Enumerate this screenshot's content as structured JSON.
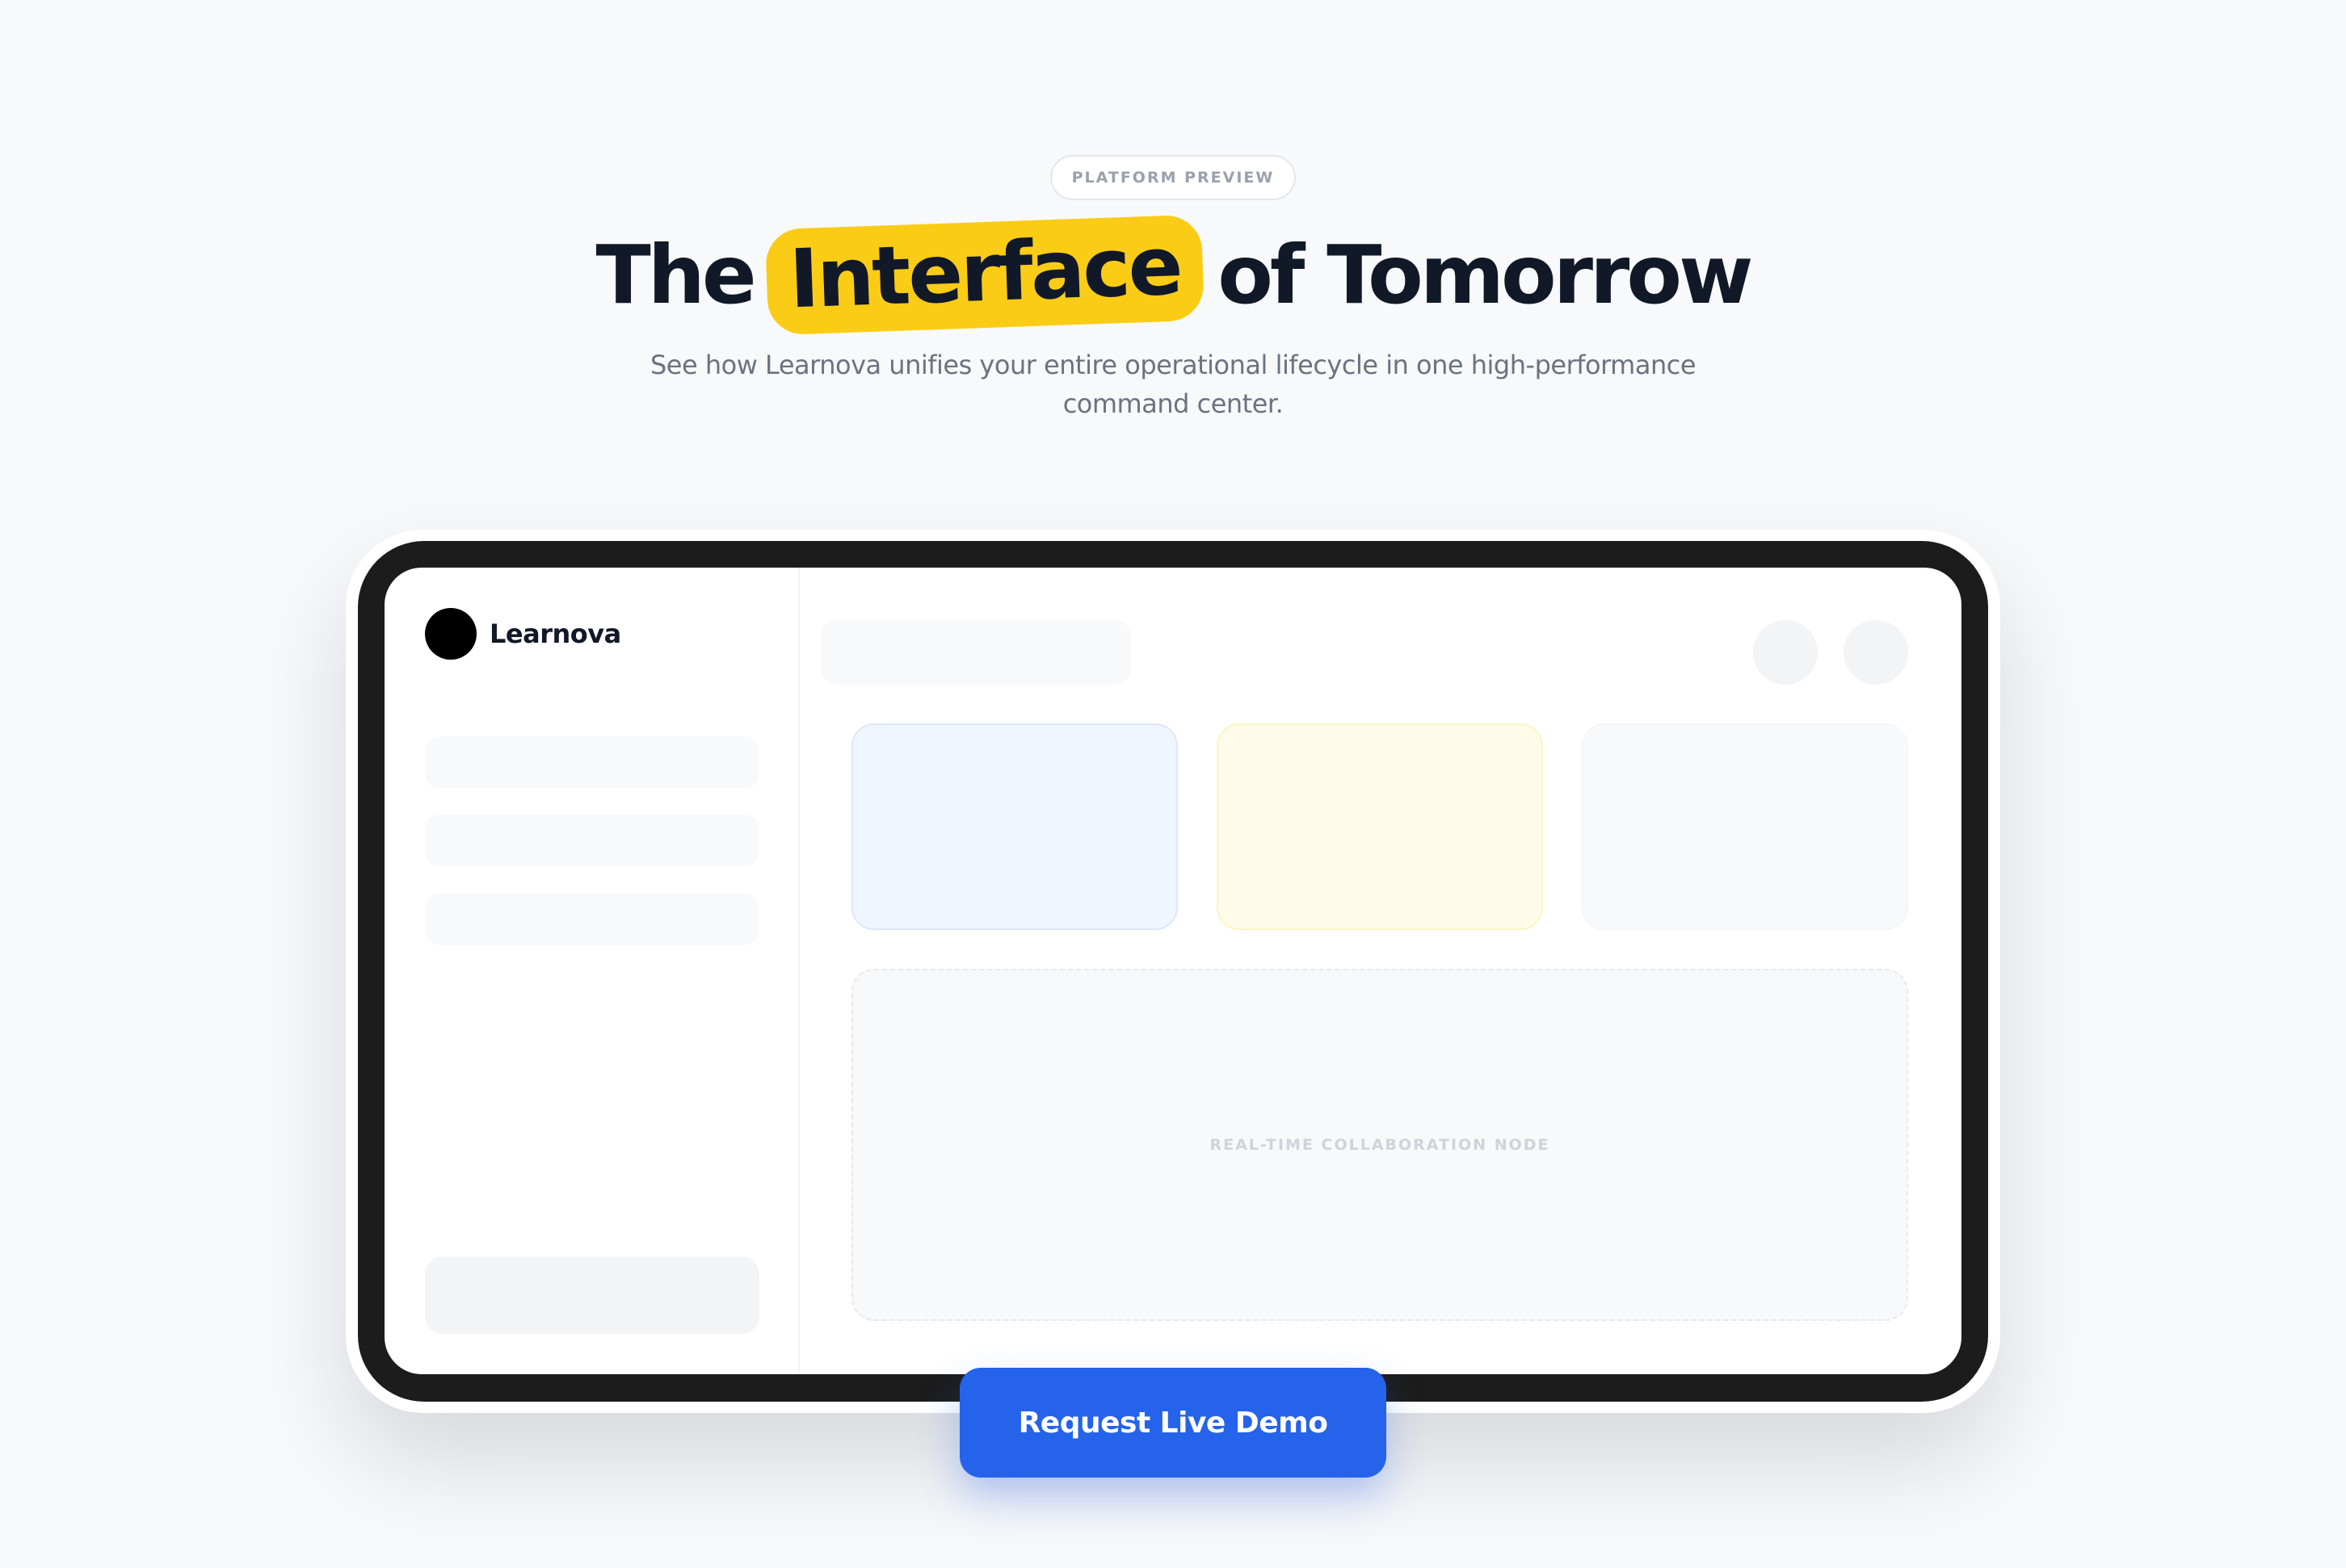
{
  "hero": {
    "eyebrow": "PLATFORM PREVIEW",
    "title_before": "The",
    "title_highlight": "Interface",
    "title_after": "of Tomorrow",
    "subtitle": "See how Learnova unifies your entire operational lifecycle in one high-performance command center."
  },
  "preview": {
    "brand_name": "Learnova",
    "collab_label": "REAL-TIME COLLABORATION NODE"
  },
  "cta": {
    "label": "Request Live Demo"
  },
  "colors": {
    "background": "#f8f9fb",
    "highlight": "#facc15",
    "device_frame": "#1c1c1c",
    "primary": "#2563eb",
    "heading": "#111827",
    "muted_text": "#6b7280",
    "card_blue": "#eff6ff",
    "card_yellow": "#fefce8",
    "card_gray": "#f8f9fb"
  }
}
